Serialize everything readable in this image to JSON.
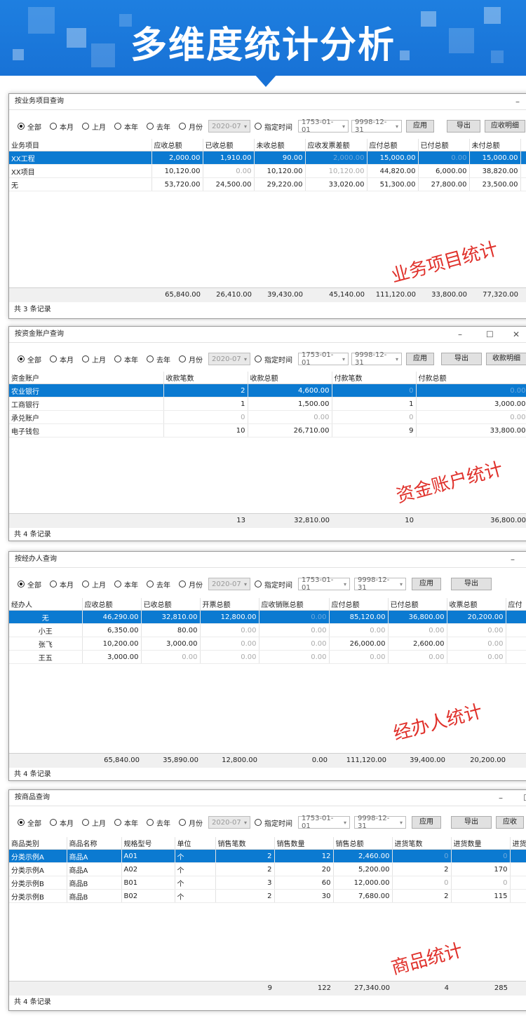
{
  "banner": {
    "title": "多维度统计分析"
  },
  "common": {
    "radios": [
      "全部",
      "本月",
      "上月",
      "本年",
      "去年",
      "月份"
    ],
    "month_value": "2020-07",
    "custom_label": "指定时间",
    "date_from": "1753-01-01",
    "date_to": "9998-12-31",
    "apply": "应用",
    "export": "导出"
  },
  "w1": {
    "title": "按业务项目查询",
    "detail_button": "应收明细",
    "headers": [
      "业务项目",
      "应收总额",
      "已收总额",
      "未收总额",
      "应收发票差额",
      "应付总额",
      "已付总额",
      "未付总额",
      ""
    ],
    "rows": [
      [
        "XX工程",
        "2,000.00",
        "1,910.00",
        "90.00",
        "2,000.00",
        "15,000.00",
        "0.00",
        "15,000.00",
        ""
      ],
      [
        "XX项目",
        "10,120.00",
        "0.00",
        "10,120.00",
        "10,120.00",
        "44,820.00",
        "6,000.00",
        "38,820.00",
        ""
      ],
      [
        "无",
        "53,720.00",
        "24,500.00",
        "29,220.00",
        "33,020.00",
        "51,300.00",
        "27,800.00",
        "23,500.00",
        ""
      ]
    ],
    "totals": [
      "65,840.00",
      "26,410.00",
      "39,430.00",
      "45,140.00",
      "111,120.00",
      "33,800.00",
      "77,320.00"
    ],
    "count": "共 3 条记录",
    "stamp": "业务项目统计"
  },
  "w2": {
    "title": "按资金账户查询",
    "detail_button": "收款明细",
    "headers": [
      "资金账户",
      "收款笔数",
      "收款总额",
      "付款笔数",
      "付款总额"
    ],
    "rows": [
      [
        "农业银行",
        "2",
        "4,600.00",
        "0",
        "0.00"
      ],
      [
        "工商银行",
        "1",
        "1,500.00",
        "1",
        "3,000.00"
      ],
      [
        "承兑账户",
        "0",
        "0.00",
        "0",
        "0.00"
      ],
      [
        "电子钱包",
        "10",
        "26,710.00",
        "9",
        "33,800.00"
      ]
    ],
    "totals": [
      "13",
      "32,810.00",
      "10",
      "36,800.00"
    ],
    "count": "共 4 条记录",
    "stamp": "资金账户统计"
  },
  "w3": {
    "title": "按经办人查询",
    "headers": [
      "经办人",
      "应收总额",
      "已收总额",
      "开票总额",
      "应收销账总额",
      "应付总额",
      "已付总额",
      "收票总额",
      "应付"
    ],
    "rows": [
      [
        "无",
        "46,290.00",
        "32,810.00",
        "12,800.00",
        "0.00",
        "85,120.00",
        "36,800.00",
        "20,200.00",
        ""
      ],
      [
        "小王",
        "6,350.00",
        "80.00",
        "0.00",
        "0.00",
        "0.00",
        "0.00",
        "0.00",
        ""
      ],
      [
        "张飞",
        "10,200.00",
        "3,000.00",
        "0.00",
        "0.00",
        "26,000.00",
        "2,600.00",
        "0.00",
        ""
      ],
      [
        "王五",
        "3,000.00",
        "0.00",
        "0.00",
        "0.00",
        "0.00",
        "0.00",
        "0.00",
        ""
      ]
    ],
    "totals": [
      "65,840.00",
      "35,890.00",
      "12,800.00",
      "0.00",
      "111,120.00",
      "39,400.00",
      "20,200.00"
    ],
    "count": "共 4 条记录",
    "stamp": "经办人统计"
  },
  "w4": {
    "title": "按商品查询",
    "detail_button": "应收",
    "headers": [
      "商品类别",
      "商品名称",
      "规格型号",
      "单位",
      "销售笔数",
      "销售数量",
      "销售总额",
      "进货笔数",
      "进货数量",
      "进货"
    ],
    "rows": [
      [
        "分类示例A",
        "商品A",
        "A01",
        "个",
        "2",
        "12",
        "2,460.00",
        "0",
        "0",
        ""
      ],
      [
        "分类示例A",
        "商品A",
        "A02",
        "个",
        "2",
        "20",
        "5,200.00",
        "2",
        "170",
        ""
      ],
      [
        "分类示例B",
        "商品B",
        "B01",
        "个",
        "3",
        "60",
        "12,000.00",
        "0",
        "0",
        ""
      ],
      [
        "分类示例B",
        "商品B",
        "B02",
        "个",
        "2",
        "30",
        "7,680.00",
        "2",
        "115",
        ""
      ]
    ],
    "totals": [
      "9",
      "122",
      "27,340.00",
      "4",
      "285"
    ],
    "count": "共 4 条记录",
    "stamp": "商品统计"
  },
  "colors": {
    "banner": "#1872d6",
    "selection": "#0b7ad1",
    "stamp": "#e0312b"
  }
}
